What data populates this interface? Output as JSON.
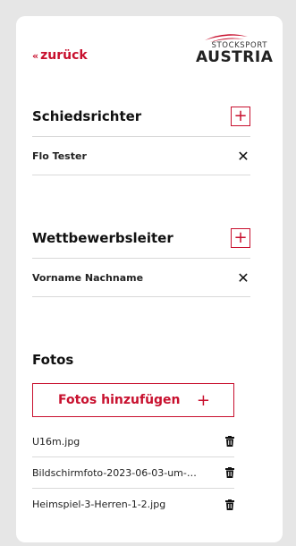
{
  "nav": {
    "back_label": "zurück",
    "back_icon": "«"
  },
  "logo": {
    "line1": "STOCKSPORT",
    "line2": "AUSTRIA"
  },
  "schiedsrichter": {
    "title": "Schiedsrichter",
    "add_icon": "+",
    "items": [
      {
        "name": "Flo Tester"
      }
    ]
  },
  "wettbewerbsleiter": {
    "title": "Wettbewerbsleiter",
    "add_icon": "+",
    "items": [
      {
        "name": "Vorname Nachname"
      }
    ]
  },
  "fotos": {
    "title": "Fotos",
    "add_label": "Fotos hinzufügen",
    "add_icon": "+",
    "files": [
      {
        "name": "U16m.jpg"
      },
      {
        "name": "Bildschirmfoto-2023-06-03-um-1..."
      },
      {
        "name": "Heimspiel-3-Herren-1-2.jpg"
      }
    ]
  },
  "remove_icon": "✕",
  "colors": {
    "accent": "#c8102e",
    "background": "#e6e6e6",
    "card": "#ffffff"
  }
}
